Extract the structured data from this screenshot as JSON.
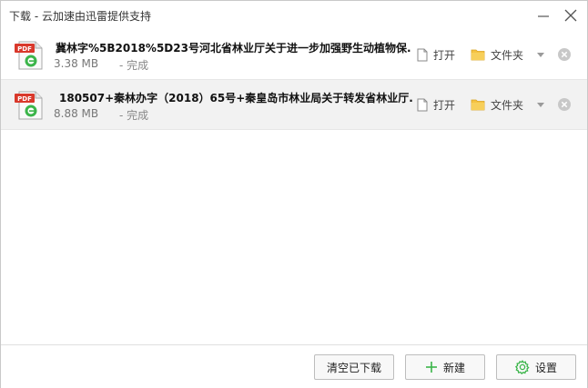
{
  "window": {
    "title": "下载 - 云加速由迅雷提供支持"
  },
  "downloads": [
    {
      "name": "冀林字%5B2018%5D23号河北省林业厅关于进一步加强野生动植物保...",
      "size": "3.38 MB",
      "status": "- 完成",
      "file_type": "PDF",
      "open_label": "打开",
      "folder_label": "文件夹"
    },
    {
      "name": "180507+秦林办字（2018）65号+秦皇岛市林业局关于转发省林业厅...",
      "size": "8.88 MB",
      "status": "- 完成",
      "file_type": "PDF",
      "open_label": "打开",
      "folder_label": "文件夹"
    }
  ],
  "footer": {
    "clear_label": "清空已下载",
    "new_label": "新建",
    "settings_label": "设置"
  },
  "colors": {
    "pdf_red": "#d9382b",
    "edge_green": "#3bb54a",
    "folder_yellow": "#f5c342",
    "settings_green": "#3bb54a"
  }
}
